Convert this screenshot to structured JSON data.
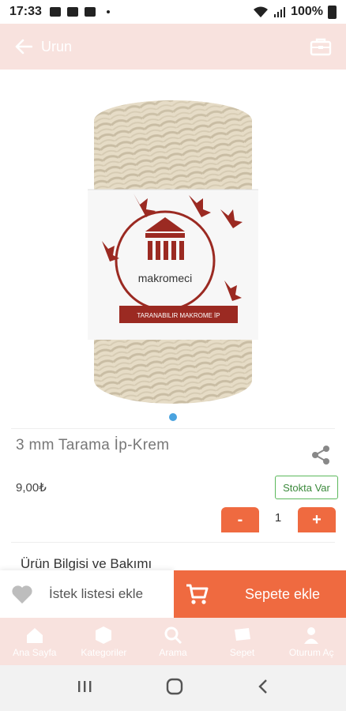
{
  "status_bar": {
    "time": "17:33",
    "battery": "100%"
  },
  "app_bar": {
    "title": "Urun",
    "back_icon": "arrow-left-icon",
    "bag_icon": "shopping-bag-icon"
  },
  "product": {
    "image_brand": "makromeci",
    "image_ribbon": "TARANABILIR MAKROME İP",
    "name": "3 mm Tarama İp-Krem",
    "price": "9,00₺",
    "stock": "Stokta Var",
    "quantity": "1",
    "minus_label": "-",
    "plus_label": "+",
    "info_heading": "Ürün Bilgisi ve Bakımı"
  },
  "actions": {
    "wishlist_label": "İstek listesi ekle",
    "add_to_cart_label": "Sepete ekle"
  },
  "bottom_nav": [
    {
      "label": "Ana Sayfa",
      "icon": "home-icon"
    },
    {
      "label": "Kategoriler",
      "icon": "categories-icon"
    },
    {
      "label": "Arama",
      "icon": "search-icon"
    },
    {
      "label": "Sepet",
      "icon": "cart-icon"
    },
    {
      "label": "Oturum Aç",
      "icon": "user-icon"
    }
  ],
  "colors": {
    "accent": "#ef6a40",
    "header_bg": "#f8e2de",
    "stock_green": "#5cb85c",
    "pager_dot": "#4aa3df"
  }
}
